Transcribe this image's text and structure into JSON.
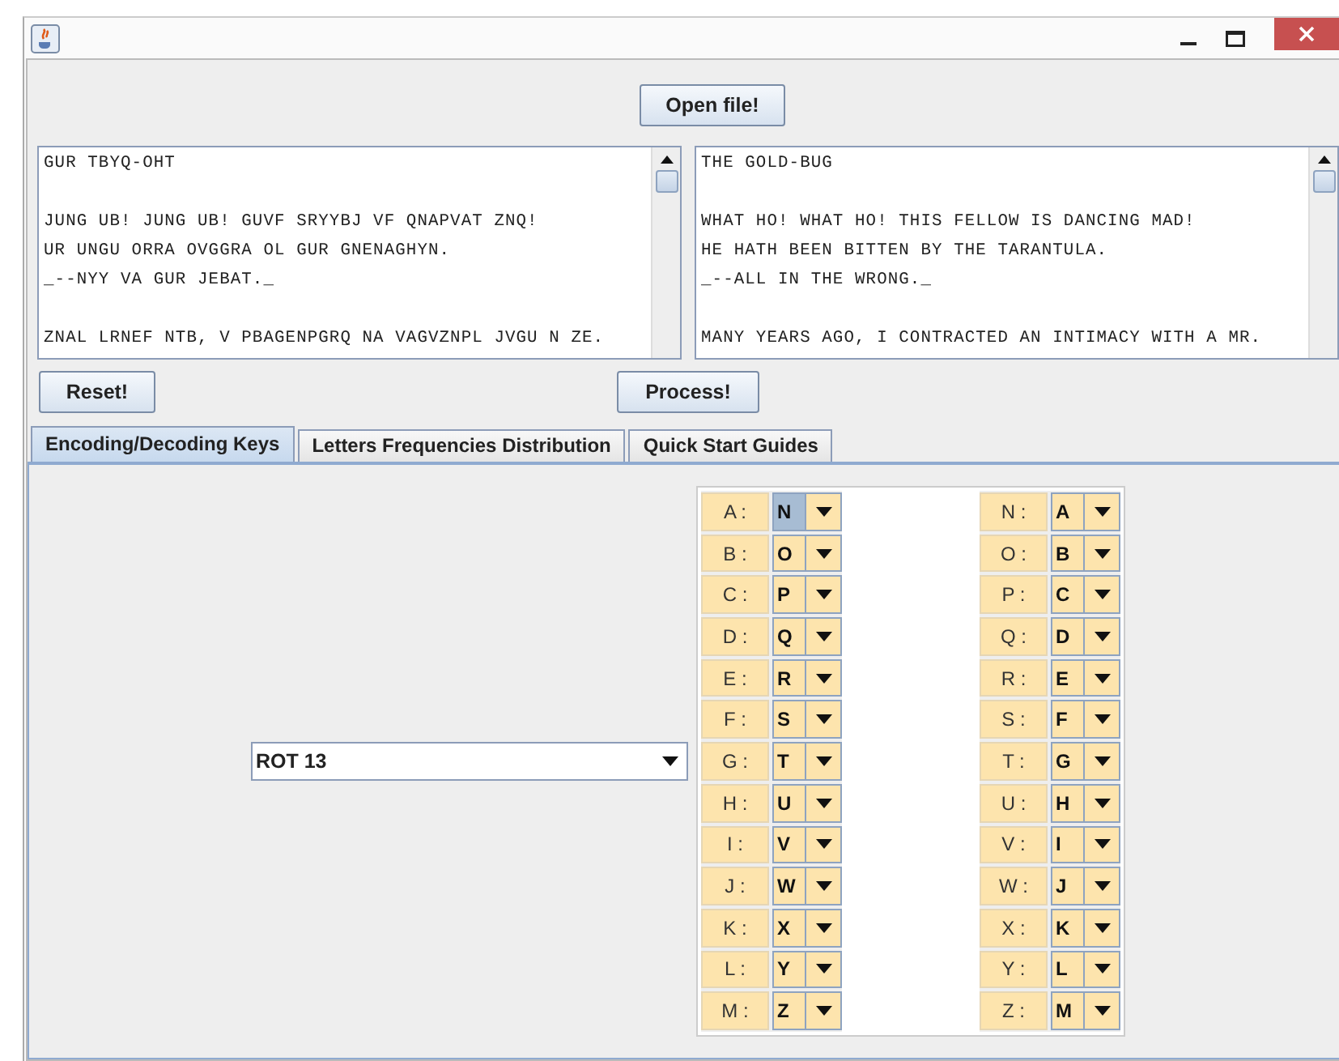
{
  "open_button": {
    "label": "Open file!"
  },
  "input_text": {
    "paragraphs": [
      [
        "GUR TBYQ-OHT"
      ],
      [
        "JUNG UB! JUNG UB! GUVF SRYYBJ VF QNAPVAT ZNQ!",
        "UR UNGU ORRA OVGGRA OL GUR GNENAGHYN.",
        "_--NYY VA GUR JEBAT._"
      ],
      [
        "ZNAL LRNEF NTB, V PBAGENPGRQ NA VAGVZNPL JVGU N ZE."
      ]
    ]
  },
  "output_text": {
    "paragraphs": [
      [
        "THE GOLD-BUG"
      ],
      [
        "WHAT HO! WHAT HO! THIS FELLOW IS DANCING MAD!",
        "HE HATH BEEN BITTEN BY THE TARANTULA.",
        "_--ALL IN THE WRONG._"
      ],
      [
        "MANY YEARS AGO, I CONTRACTED AN INTIMACY WITH A MR."
      ]
    ]
  },
  "reset_button": {
    "label": "Reset!"
  },
  "process_button": {
    "label": "Process!"
  },
  "tabs": [
    {
      "label": "Encoding/Decoding Keys",
      "selected": true
    },
    {
      "label": "Letters Frequencies Distribution",
      "selected": false
    },
    {
      "label": "Quick Start Guides",
      "selected": false
    }
  ],
  "cipher_select": {
    "value": "ROT 13"
  },
  "key_map": [
    {
      "letter": "A :",
      "key": "N",
      "selected": true
    },
    {
      "letter": "B :",
      "key": "O",
      "selected": false
    },
    {
      "letter": "C :",
      "key": "P",
      "selected": false
    },
    {
      "letter": "D :",
      "key": "Q",
      "selected": false
    },
    {
      "letter": "E :",
      "key": "R",
      "selected": false
    },
    {
      "letter": "F :",
      "key": "S",
      "selected": false
    },
    {
      "letter": "G :",
      "key": "T",
      "selected": false
    },
    {
      "letter": "H :",
      "key": "U",
      "selected": false
    },
    {
      "letter": "I :",
      "key": "V",
      "selected": false
    },
    {
      "letter": "J :",
      "key": "W",
      "selected": false
    },
    {
      "letter": "K :",
      "key": "X",
      "selected": false
    },
    {
      "letter": "L :",
      "key": "Y",
      "selected": false
    },
    {
      "letter": "M :",
      "key": "Z",
      "selected": false
    },
    {
      "letter": "N :",
      "key": "A",
      "selected": false
    },
    {
      "letter": "O :",
      "key": "B",
      "selected": false
    },
    {
      "letter": "P :",
      "key": "C",
      "selected": false
    },
    {
      "letter": "Q :",
      "key": "D",
      "selected": false
    },
    {
      "letter": "R :",
      "key": "E",
      "selected": false
    },
    {
      "letter": "S :",
      "key": "F",
      "selected": false
    },
    {
      "letter": "T :",
      "key": "G",
      "selected": false
    },
    {
      "letter": "U :",
      "key": "H",
      "selected": false
    },
    {
      "letter": "V :",
      "key": "I",
      "selected": false
    },
    {
      "letter": "W :",
      "key": "J",
      "selected": false
    },
    {
      "letter": "X :",
      "key": "K",
      "selected": false
    },
    {
      "letter": "Y :",
      "key": "L",
      "selected": false
    },
    {
      "letter": "Z :",
      "key": "M",
      "selected": false
    }
  ]
}
